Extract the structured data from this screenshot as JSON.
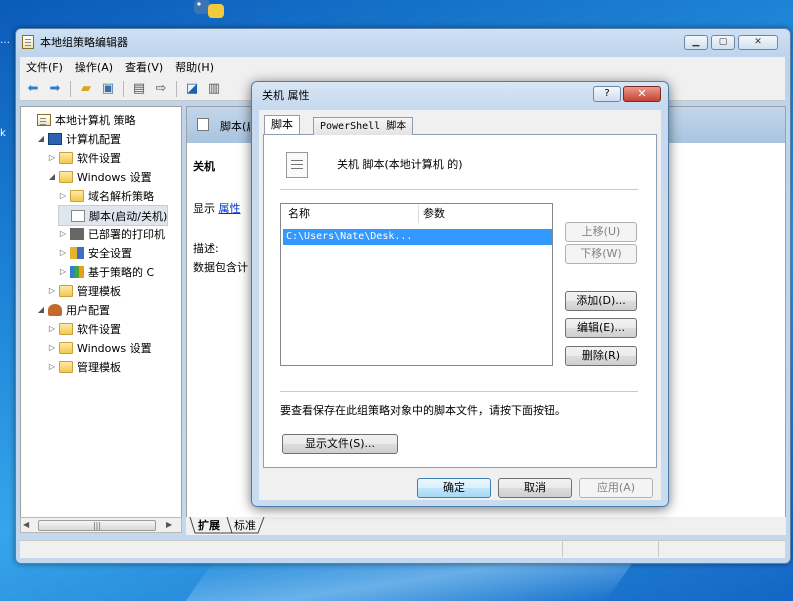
{
  "window": {
    "title": "本地组策略编辑器"
  },
  "menu": [
    "文件(F)",
    "操作(A)",
    "查看(V)",
    "帮助(H)"
  ],
  "tree": [
    {
      "label": "本地计算机 策略",
      "indent": 0,
      "exp": "",
      "icon": "ico-doc"
    },
    {
      "label": "计算机配置",
      "indent": 1,
      "exp": "◢",
      "icon": "pc"
    },
    {
      "label": "软件设置",
      "indent": 2,
      "exp": "▷",
      "icon": "folder"
    },
    {
      "label": "Windows 设置",
      "indent": 2,
      "exp": "◢",
      "icon": "folder"
    },
    {
      "label": "域名解析策略",
      "indent": 3,
      "exp": "▷",
      "icon": "folder"
    },
    {
      "label": "脚本(启动/关机)",
      "indent": 3,
      "exp": "",
      "icon": "scripti"
    },
    {
      "label": "已部署的打印机",
      "indent": 3,
      "exp": "▷",
      "icon": "printer"
    },
    {
      "label": "安全设置",
      "indent": 3,
      "exp": "▷",
      "icon": "shieldic"
    },
    {
      "label": "基于策略的 C",
      "indent": 3,
      "exp": "▷",
      "icon": "barsic"
    },
    {
      "label": "管理模板",
      "indent": 2,
      "exp": "▷",
      "icon": "folder"
    },
    {
      "label": "用户配置",
      "indent": 1,
      "exp": "◢",
      "icon": "user"
    },
    {
      "label": "软件设置",
      "indent": 2,
      "exp": "▷",
      "icon": "folder"
    },
    {
      "label": "Windows 设置",
      "indent": 2,
      "exp": "▷",
      "icon": "folder"
    },
    {
      "label": "管理模板",
      "indent": 2,
      "exp": "▷",
      "icon": "folder"
    }
  ],
  "right_pane": {
    "header": "脚本(启动/关机)",
    "section": "关机",
    "show_label": "显示",
    "properties_link": "属性",
    "desc_label": "描述:",
    "desc_text": "数据包含计"
  },
  "bottom_tabs": [
    "扩展",
    "标准"
  ],
  "dialog": {
    "title": "关机 属性",
    "help_label": "?",
    "close_label": "✕",
    "tabs": [
      "脚本",
      "PowerShell 脚本"
    ],
    "heading": "关机 脚本(本地计算机 的)",
    "col_name": "名称",
    "col_params": "参数",
    "rows": [
      {
        "name": "C:\\Users\\Nate\\Desk...",
        "params": ""
      }
    ],
    "move_up": "上移(U)",
    "move_down": "下移(W)",
    "add": "添加(D)...",
    "edit": "编辑(E)...",
    "remove": "删除(R)",
    "info": "要查看保存在此组策略对象中的脚本文件，请按下面按钮。",
    "show_files": "显示文件(S)...",
    "ok": "确定",
    "cancel": "取消",
    "apply": "应用(A)"
  },
  "colors": {
    "selection": "#3399ff",
    "link": "#0033cc",
    "close": "#c5412f"
  }
}
